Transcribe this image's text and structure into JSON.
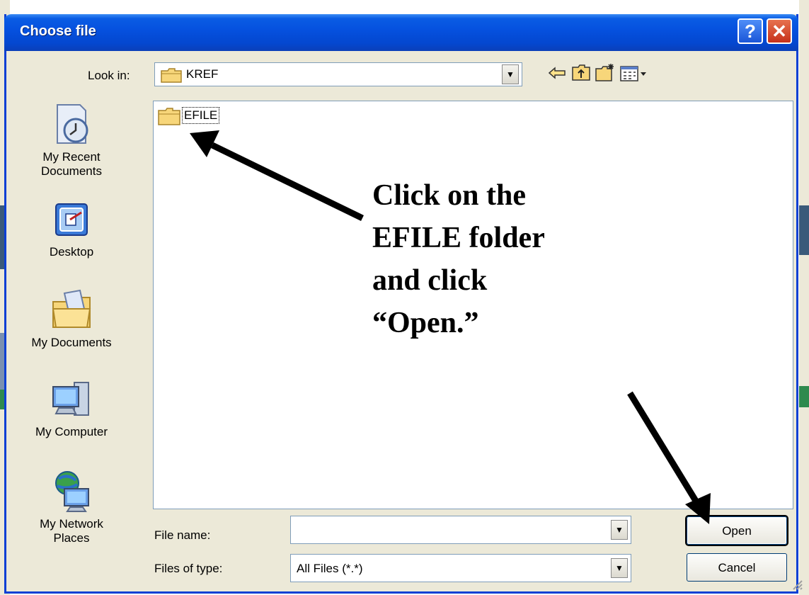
{
  "dialog": {
    "title": "Choose file",
    "help_glyph": "?",
    "close_glyph": "✕"
  },
  "look_in": {
    "label": "Look in:",
    "value": "KREF",
    "icon": "folder-icon"
  },
  "toolbar": {
    "back_icon": "back-arrow-icon",
    "up_icon": "up-folder-icon",
    "new_folder_icon": "new-folder-icon",
    "view_menu_icon": "view-menu-icon"
  },
  "places": [
    {
      "label_1": "My Recent",
      "label_2": "Documents",
      "icon": "recent-documents-icon"
    },
    {
      "label_1": "Desktop",
      "label_2": "",
      "icon": "desktop-icon"
    },
    {
      "label_1": "My Documents",
      "label_2": "",
      "icon": "my-documents-icon"
    },
    {
      "label_1": "My Computer",
      "label_2": "",
      "icon": "my-computer-icon"
    },
    {
      "label_1": "My Network",
      "label_2": "Places",
      "icon": "network-places-icon"
    }
  ],
  "files": [
    {
      "name": "EFILE",
      "icon": "folder-icon",
      "focused": true
    }
  ],
  "filename": {
    "label": "File name:",
    "value": ""
  },
  "filetype": {
    "label": "Files of type:",
    "value": "All Files (*.*)"
  },
  "buttons": {
    "open": "Open",
    "cancel": "Cancel"
  },
  "annotation": {
    "line1": "Click on the",
    "line2": "EFILE folder",
    "line3": "and click",
    "line4": "“Open.”"
  },
  "colors": {
    "titlebar": "#0550de",
    "dialog_bg": "#ece9d8",
    "border": "#7f9db9"
  }
}
